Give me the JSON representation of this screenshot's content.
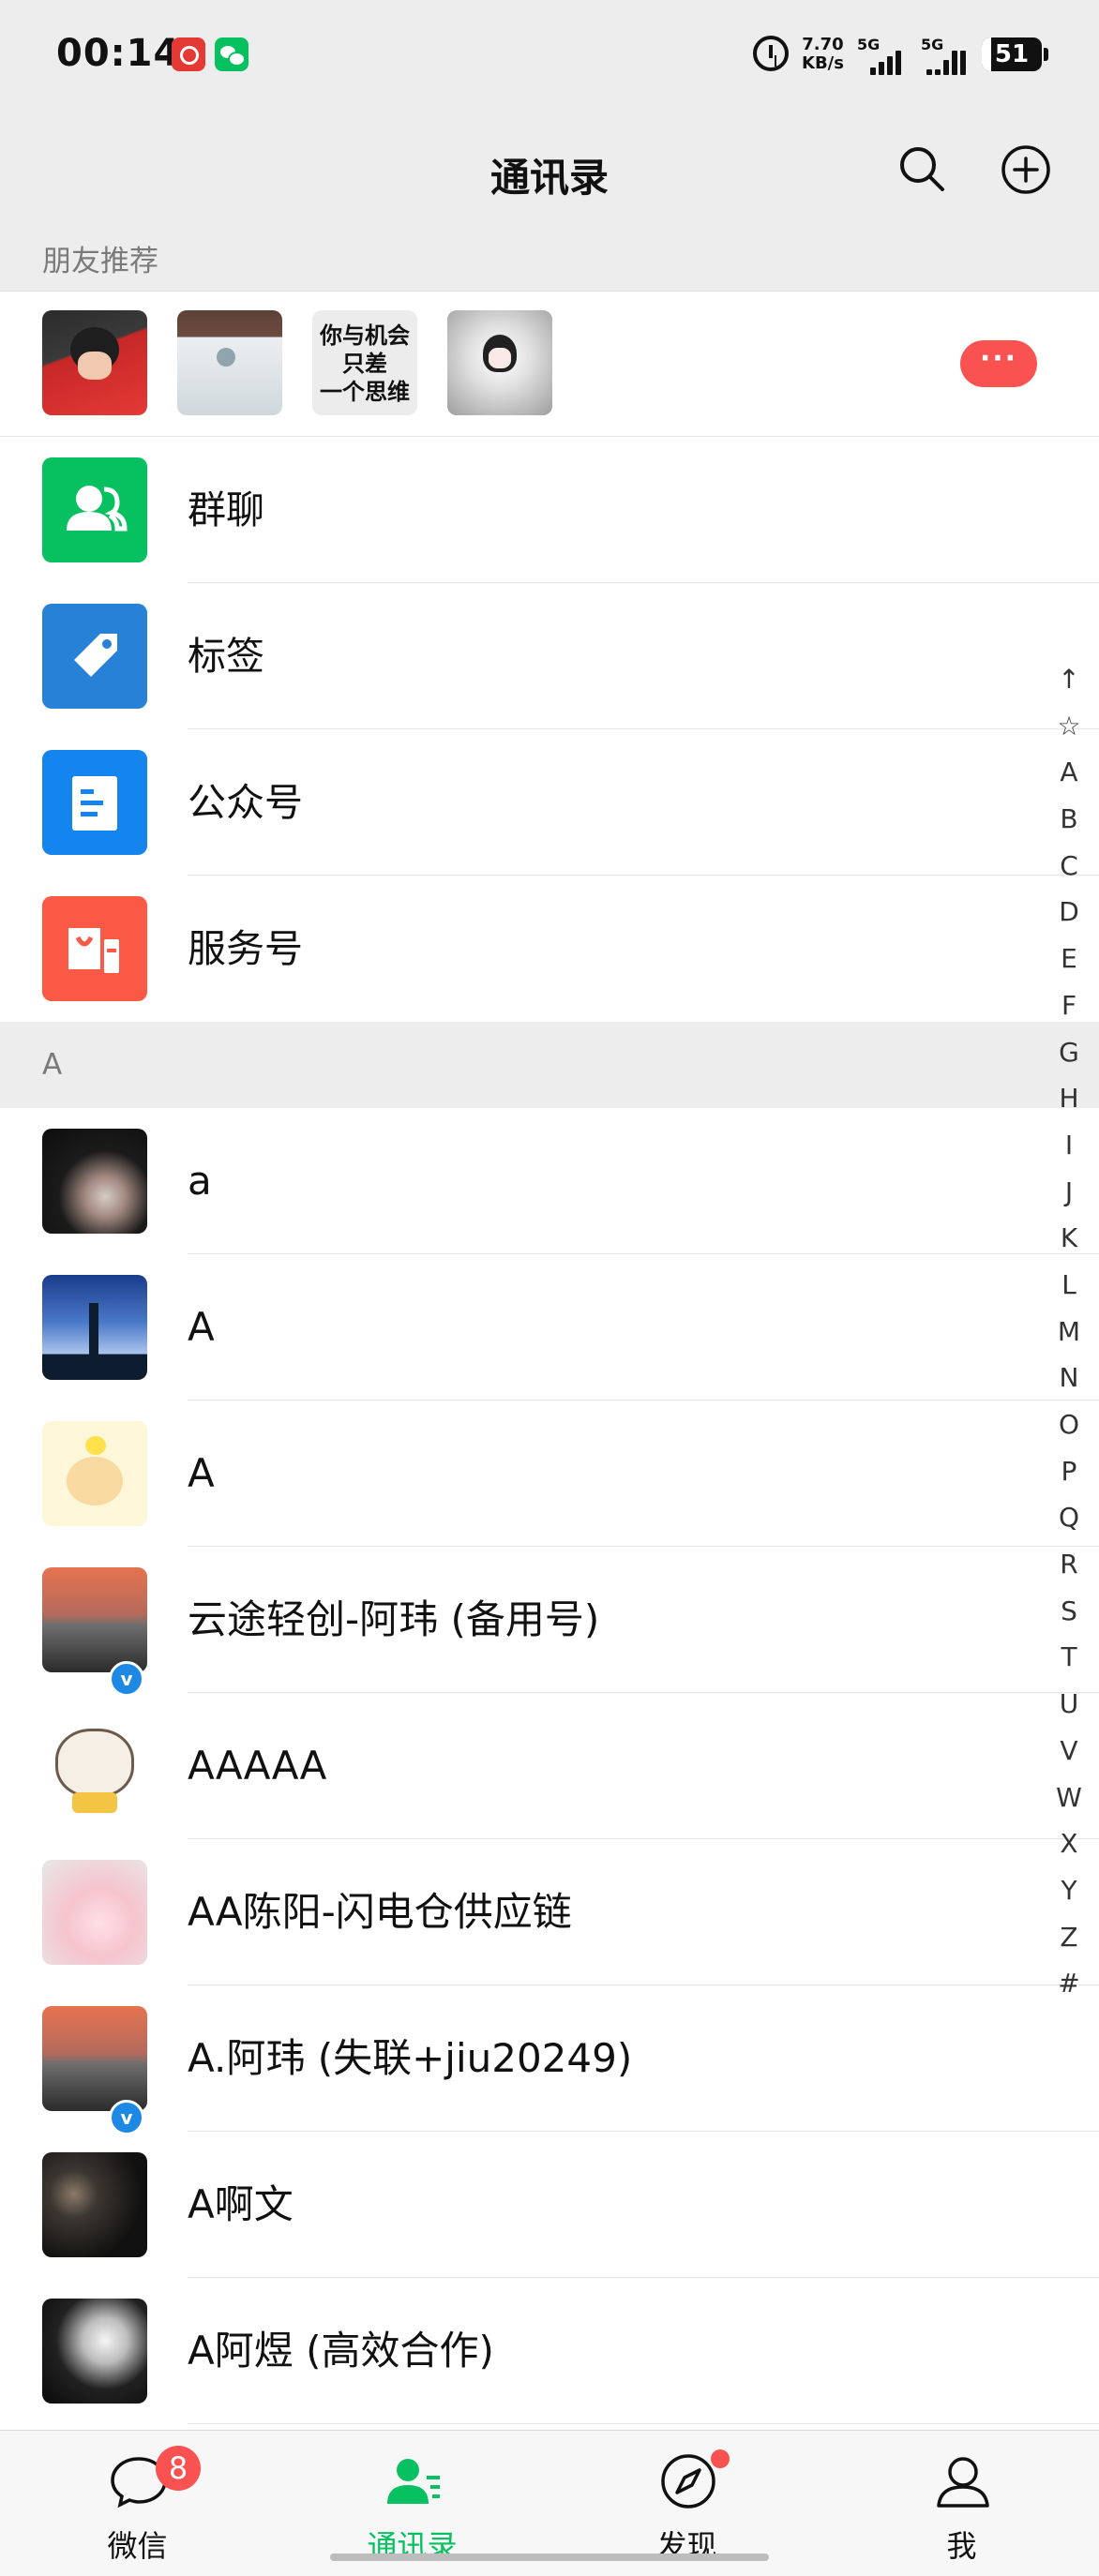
{
  "status_bar": {
    "time": "00:14",
    "net_speed_value": "7.70",
    "net_speed_unit": "KB/s",
    "network_1": "5G",
    "network_2": "5G",
    "battery": "51",
    "icons": [
      "netease-music-icon",
      "wechat-icon",
      "alarm-icon",
      "signal-icon",
      "battery-icon"
    ]
  },
  "nav": {
    "title": "通讯录",
    "search_icon": "search-icon",
    "add_icon": "add-icon"
  },
  "friends_section": {
    "title": "朋友推荐",
    "text_avatar": "你与机会\n只差\n一个思维",
    "more_label": "···"
  },
  "features": [
    {
      "label": "群聊",
      "icon": "group-chat-icon",
      "color": "#07c160"
    },
    {
      "label": "标签",
      "icon": "tag-icon",
      "color": "#2782d7"
    },
    {
      "label": "公众号",
      "icon": "official-account-icon",
      "color": "#1485ee"
    },
    {
      "label": "服务号",
      "icon": "service-account-icon",
      "color": "#fa5a45"
    }
  ],
  "section_a": {
    "letter": "A"
  },
  "contacts": [
    {
      "name": "a",
      "verified": false
    },
    {
      "name": "A",
      "verified": false
    },
    {
      "name": "A",
      "verified": false
    },
    {
      "name": "云途轻创-阿玮 (备用号)",
      "verified": true
    },
    {
      "name": "AAAAA",
      "verified": false
    },
    {
      "name": "AA陈阳-闪电仓供应链",
      "verified": false
    },
    {
      "name": "A.阿玮 (失联+jiu20249)",
      "verified": true
    },
    {
      "name": "A啊文",
      "verified": false
    },
    {
      "name": "A阿煜 (高效合作)",
      "verified": false
    }
  ],
  "verified_mark": "v",
  "index_letters": [
    "↑",
    "☆",
    "A",
    "B",
    "C",
    "D",
    "E",
    "F",
    "G",
    "H",
    "I",
    "J",
    "K",
    "L",
    "M",
    "N",
    "O",
    "P",
    "Q",
    "R",
    "S",
    "T",
    "U",
    "V",
    "W",
    "X",
    "Y",
    "Z",
    "#"
  ],
  "tabs": [
    {
      "label": "微信",
      "icon": "chat-icon",
      "badge": "8"
    },
    {
      "label": "通讯录",
      "icon": "contacts-icon",
      "active": true
    },
    {
      "label": "发现",
      "icon": "discover-icon",
      "dot": true
    },
    {
      "label": "我",
      "icon": "me-icon"
    }
  ],
  "colors": {
    "accent": "#07c160",
    "badge": "#fa5151",
    "background": "#ededed"
  }
}
